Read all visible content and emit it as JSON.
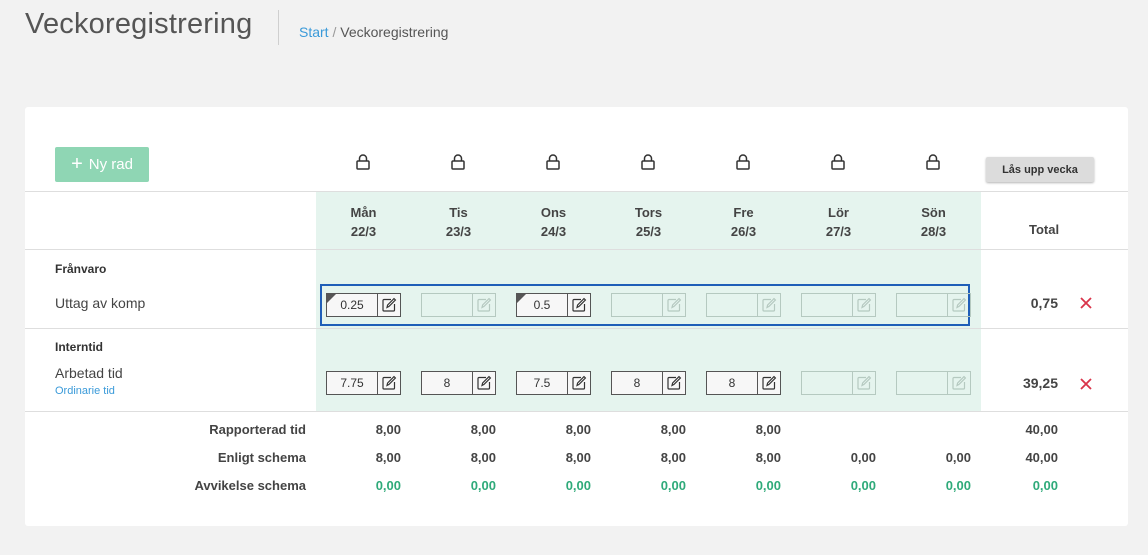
{
  "header": {
    "title": "Veckoregistrering",
    "breadcrumb": {
      "start": "Start",
      "separator": "/",
      "current": "Veckoregistrering"
    }
  },
  "toolbar": {
    "new_row_label": "Ny rad",
    "new_row_icon": "plus-icon",
    "unlock_label": "Lås upp vecka"
  },
  "days": [
    {
      "name": "Mån",
      "date": "22/3"
    },
    {
      "name": "Tis",
      "date": "23/3"
    },
    {
      "name": "Ons",
      "date": "24/3"
    },
    {
      "name": "Tors",
      "date": "25/3"
    },
    {
      "name": "Fre",
      "date": "26/3"
    },
    {
      "name": "Lör",
      "date": "27/3"
    },
    {
      "name": "Sön",
      "date": "28/3"
    }
  ],
  "total_header": "Total",
  "sections": [
    {
      "title": "Frånvaro",
      "rows": [
        {
          "label": "Uttag av komp",
          "sublabel": "",
          "values": [
            "0.25",
            "",
            "0.5",
            "",
            "",
            "",
            ""
          ],
          "total": "0,75"
        }
      ]
    },
    {
      "title": "Interntid",
      "rows": [
        {
          "label": "Arbetad tid",
          "sublabel": "Ordinarie tid",
          "values": [
            "7.75",
            "8",
            "7.5",
            "8",
            "8",
            "",
            ""
          ],
          "total": "39,25"
        }
      ]
    }
  ],
  "summary": [
    {
      "label": "Rapporterad tid",
      "values": [
        "8,00",
        "8,00",
        "8,00",
        "8,00",
        "8,00",
        "",
        ""
      ],
      "total": "40,00",
      "color": "#444444"
    },
    {
      "label": "Enligt schema",
      "values": [
        "8,00",
        "8,00",
        "8,00",
        "8,00",
        "8,00",
        "0,00",
        "0,00"
      ],
      "total": "40,00",
      "color": "#444444"
    },
    {
      "label": "Avvikelse schema",
      "values": [
        "0,00",
        "0,00",
        "0,00",
        "0,00",
        "0,00",
        "0,00",
        "0,00"
      ],
      "total": "0,00",
      "color": "#2faa7a"
    }
  ],
  "colors": {
    "accent_green": "#8fd6b4",
    "link": "#3a9ad9",
    "delete": "#d9344a",
    "selection": "#1f5eb8"
  }
}
